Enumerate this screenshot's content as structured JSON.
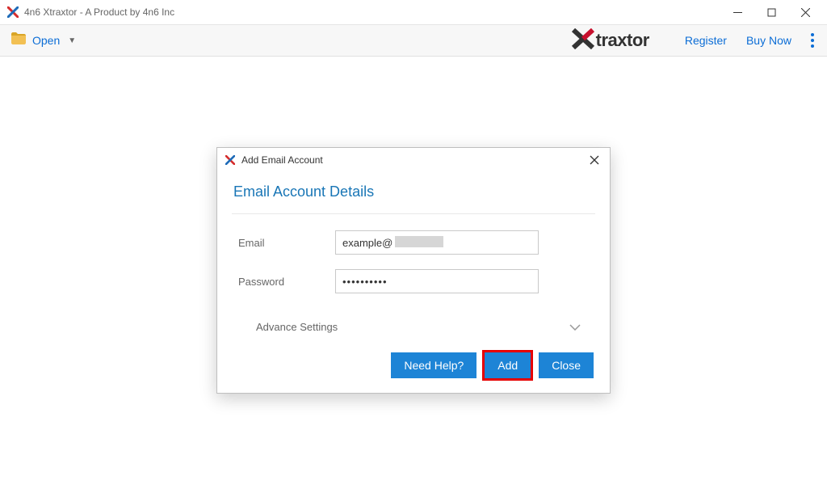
{
  "window": {
    "title": "4n6 Xtraxtor - A Product by 4n6 Inc"
  },
  "toolbar": {
    "open_label": "Open",
    "brand": "traxtor",
    "register_label": "Register",
    "buynow_label": "Buy Now"
  },
  "dialog": {
    "title": "Add Email Account",
    "heading": "Email Account Details",
    "email_label": "Email",
    "email_value": "example@",
    "password_label": "Password",
    "password_value": "••••••••••",
    "advance_label": "Advance Settings",
    "need_help_label": "Need Help?",
    "add_label": "Add",
    "close_label": "Close"
  }
}
